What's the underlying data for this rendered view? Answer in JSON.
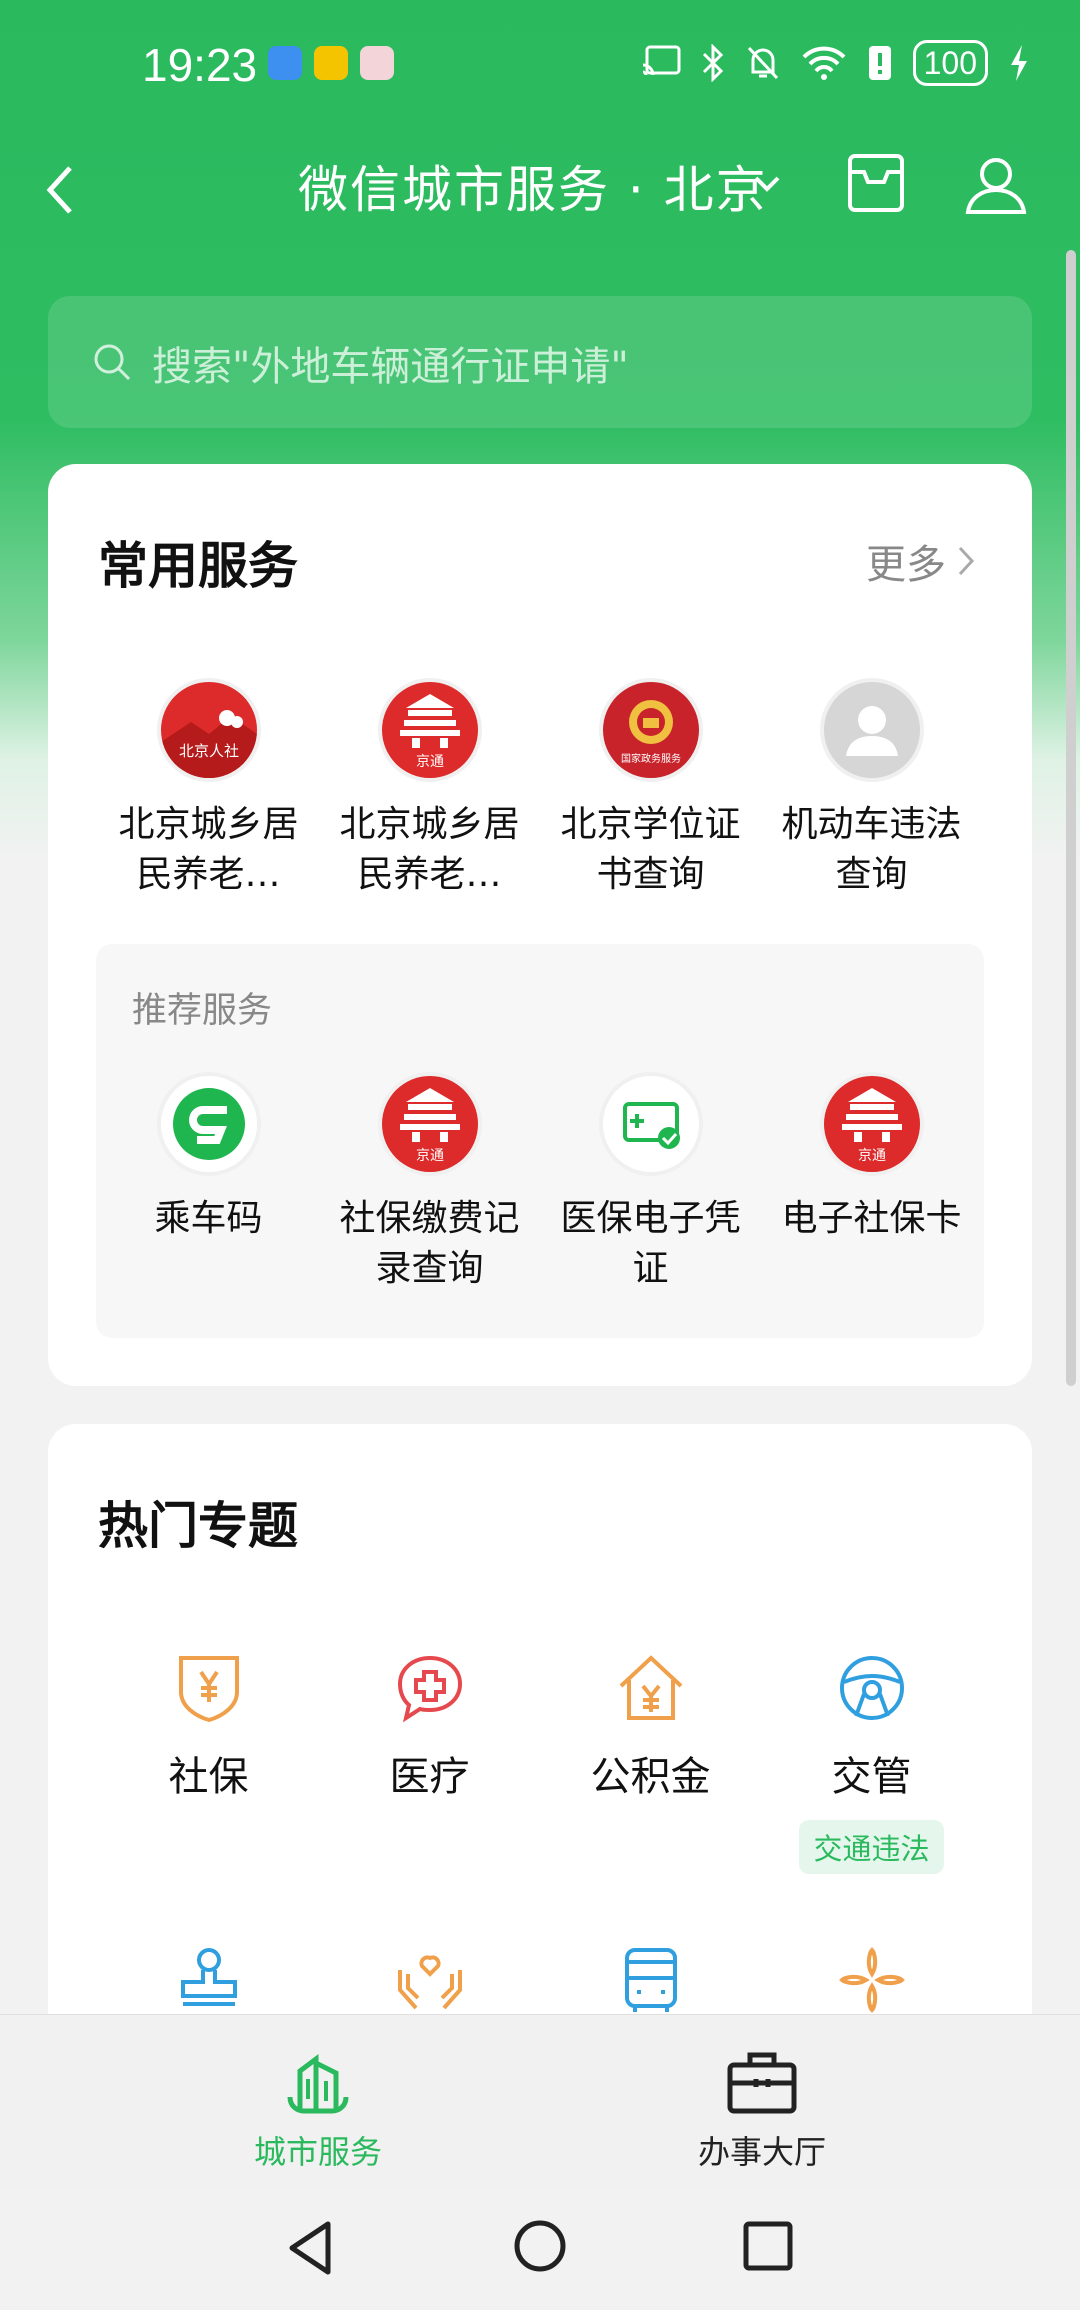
{
  "status_bar": {
    "time": "19:23",
    "battery": "100"
  },
  "nav": {
    "title": "微信城市服务 · 北京"
  },
  "search": {
    "placeholder": "搜索\"外地车辆通行证申请\""
  },
  "common": {
    "title": "常用服务",
    "more": "更多",
    "items": [
      {
        "label": "北京城乡居\n民养老…",
        "logo_text": "北京人社",
        "icon": "beijing-hrss-logo"
      },
      {
        "label": "北京城乡居\n民养老…",
        "logo_text": "京通",
        "icon": "jingtong-logo"
      },
      {
        "label": "北京学位证\n书查询",
        "logo_text": "国家政务服务",
        "icon": "national-emblem-logo"
      },
      {
        "label": "机动车违法\n查询",
        "icon": "default-avatar-logo"
      }
    ]
  },
  "recommended": {
    "title": "推荐服务",
    "items": [
      {
        "label": "乘车码",
        "icon": "bus-code-logo"
      },
      {
        "label": "社保缴费记\n录查询",
        "logo_text": "京通",
        "icon": "jingtong-logo"
      },
      {
        "label": "医保电子凭\n证",
        "icon": "medical-insurance-logo"
      },
      {
        "label": "电子社保卡",
        "logo_text": "京通",
        "icon": "jingtong-logo"
      }
    ]
  },
  "topics": {
    "title": "热门专题",
    "items": [
      {
        "label": "社保",
        "icon": "shield-yen-icon"
      },
      {
        "label": "医疗",
        "icon": "medical-cross-icon"
      },
      {
        "label": "公积金",
        "icon": "house-yen-icon"
      },
      {
        "label": "交管",
        "icon": "steering-wheel-icon",
        "tag": "交通违法"
      }
    ],
    "row2_icons": [
      "stamp-icon",
      "hands-heart-icon",
      "bus-icon",
      "clover-icon"
    ]
  },
  "tabbar": {
    "items": [
      {
        "label": "城市服务",
        "active": true
      },
      {
        "label": "办事大厅",
        "active": false
      }
    ]
  },
  "colors": {
    "brand_green": "#2bb95e",
    "logo_red": "#dd2a2a",
    "topic_orange": "#f0a04b",
    "topic_red": "#e5484d",
    "topic_blue": "#2f9fe0"
  }
}
